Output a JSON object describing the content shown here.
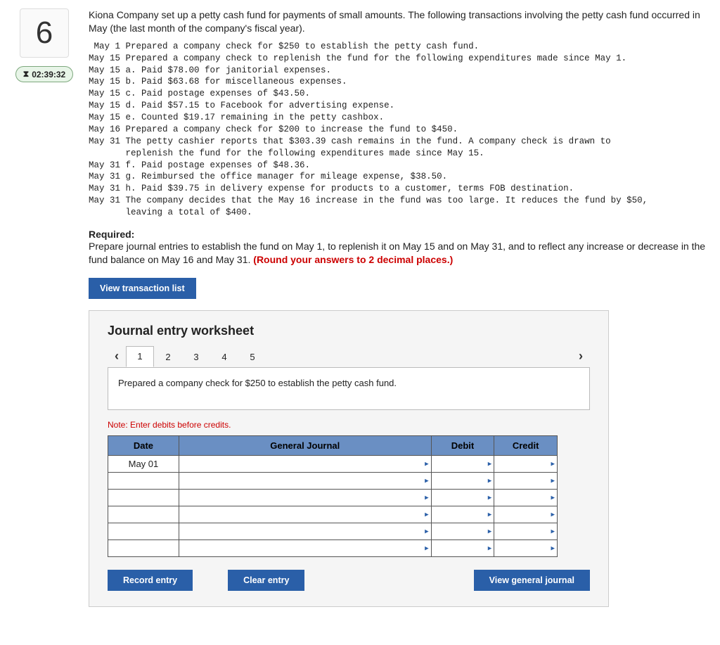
{
  "question_number": "6",
  "timer": "02:39:32",
  "intro": "Kiona Company set up a petty cash fund for payments of small amounts. The following transactions involving the petty cash fund occurred in May (the last month of the company's fiscal year).",
  "transactions_block": " May 1 Prepared a company check for $250 to establish the petty cash fund.\nMay 15 Prepared a company check to replenish the fund for the following expenditures made since May 1.\nMay 15 a. Paid $78.00 for janitorial expenses.\nMay 15 b. Paid $63.68 for miscellaneous expenses.\nMay 15 c. Paid postage expenses of $43.50.\nMay 15 d. Paid $57.15 to Facebook for advertising expense.\nMay 15 e. Counted $19.17 remaining in the petty cashbox.\nMay 16 Prepared a company check for $200 to increase the fund to $450.\nMay 31 The petty cashier reports that $303.39 cash remains in the fund. A company check is drawn to\n       replenish the fund for the following expenditures made since May 15.\nMay 31 f. Paid postage expenses of $48.36.\nMay 31 g. Reimbursed the office manager for mileage expense, $38.50.\nMay 31 h. Paid $39.75 in delivery expense for products to a customer, terms FOB destination.\nMay 31 The company decides that the May 16 increase in the fund was too large. It reduces the fund by $50,\n       leaving a total of $400.",
  "required_label": "Required:",
  "required_text": "Prepare journal entries to establish the fund on May 1, to replenish it on May 15 and on May 31, and to reflect any increase or decrease in the fund balance on May 16 and May 31. ",
  "required_red": "(Round your answers to 2 decimal places.)",
  "buttons": {
    "view_txn": "View transaction list",
    "record": "Record entry",
    "clear": "Clear entry",
    "view_gj": "View general journal"
  },
  "worksheet": {
    "title": "Journal entry worksheet",
    "tabs": [
      "1",
      "2",
      "3",
      "4",
      "5"
    ],
    "active_tab": 0,
    "description": "Prepared a company check for $250 to establish the petty cash fund.",
    "note": "Note: Enter debits before credits.",
    "headers": {
      "date": "Date",
      "gj": "General Journal",
      "debit": "Debit",
      "credit": "Credit"
    },
    "rows": [
      {
        "date": "May 01",
        "gj": "",
        "debit": "",
        "credit": ""
      },
      {
        "date": "",
        "gj": "",
        "debit": "",
        "credit": ""
      },
      {
        "date": "",
        "gj": "",
        "debit": "",
        "credit": ""
      },
      {
        "date": "",
        "gj": "",
        "debit": "",
        "credit": ""
      },
      {
        "date": "",
        "gj": "",
        "debit": "",
        "credit": ""
      },
      {
        "date": "",
        "gj": "",
        "debit": "",
        "credit": ""
      }
    ]
  }
}
